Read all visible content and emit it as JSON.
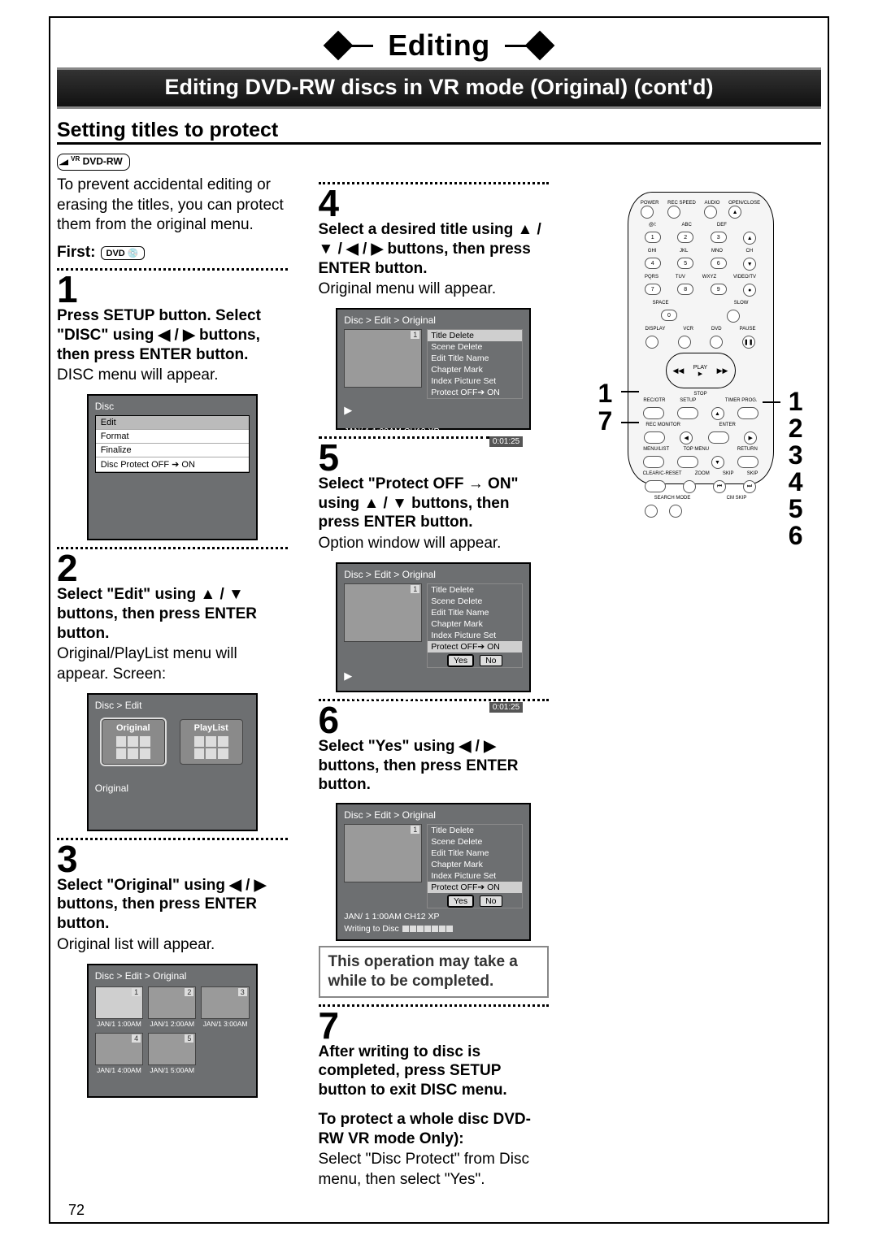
{
  "chapter_title": "Editing",
  "section_banner": "Editing DVD-RW discs in VR mode (Original) (cont'd)",
  "subheading": "Setting titles to protect",
  "dvdrw_badge_top": "VR",
  "dvdrw_badge": "DVD-RW",
  "intro": "To prevent accidental editing or erasing the titles, you can protect them from the original menu.",
  "first_label": "First:",
  "dvd_icon_label": "DVD",
  "page_number": "72",
  "steps": {
    "s1": {
      "num": "1",
      "head": "Press SETUP button. Select \"DISC\" using ◀ / ▶ buttons, then press ENTER button.",
      "body": "DISC menu will appear."
    },
    "s2": {
      "num": "2",
      "head": "Select \"Edit\" using ▲ / ▼ buttons, then press ENTER button.",
      "body": "Original/PlayList menu will appear. Screen:"
    },
    "s3": {
      "num": "3",
      "head": "Select \"Original\" using ◀ / ▶ buttons, then press ENTER button.",
      "body": "Original list will appear."
    },
    "s4": {
      "num": "4",
      "head": "Select a desired title using ▲ / ▼ / ◀ / ▶ buttons, then press ENTER button.",
      "body": "Original menu will appear."
    },
    "s5": {
      "num": "5",
      "head": "Select \"Protect OFF → ON\" using ▲ / ▼ buttons, then press ENTER button.",
      "body": "Option window will appear."
    },
    "s6": {
      "num": "6",
      "head": "Select \"Yes\" using ◀ / ▶ buttons, then press ENTER button."
    },
    "s7": {
      "num": "7",
      "head": "After writing to disc is completed, press SETUP button to exit DISC menu."
    }
  },
  "note_box": "This operation may take a while to be completed.",
  "whole_disc": {
    "head": "To protect a whole disc DVD-RW VR mode Only):",
    "body": "Select \"Disc Protect\" from Disc menu, then select \"Yes\"."
  },
  "screens": {
    "disc_menu": {
      "crumb": "Disc",
      "items": [
        "Edit",
        "Format",
        "Finalize",
        "Disc Protect OFF ➔ ON"
      ]
    },
    "orig_play": {
      "crumb": "Disc > Edit",
      "left": "Original",
      "right": "PlayList",
      "caption": "Original"
    },
    "orig_list": {
      "crumb": "Disc > Edit > Original",
      "thumbs": [
        {
          "n": "1",
          "t": "JAN/1  1:00AM"
        },
        {
          "n": "2",
          "t": "JAN/1  2:00AM"
        },
        {
          "n": "3",
          "t": "JAN/1  3:00AM"
        },
        {
          "n": "4",
          "t": "JAN/1  4:00AM"
        },
        {
          "n": "5",
          "t": "JAN/1  5:00AM"
        }
      ]
    },
    "edit_menu": {
      "crumb": "Disc > Edit > Original",
      "items": [
        "Title Delete",
        "Scene Delete",
        "Edit Title Name",
        "Chapter Mark",
        "Index Picture Set",
        "Protect OFF➔ ON"
      ],
      "footer_left": "JAN/ 1   1:00AM  CH12    XP",
      "footer_right": "0:01:25"
    },
    "yesno": {
      "yes": "Yes",
      "no": "No"
    },
    "writing": "Writing to Disc"
  },
  "remote": {
    "row1": [
      "POWER",
      "REC SPEED",
      "AUDIO",
      "OPEN/CLOSE"
    ],
    "numpad_labels": [
      "@/:",
      "ABC",
      "DEF",
      "",
      "GHI",
      "JKL",
      "MNO",
      "CH",
      "PQRS",
      "TUV",
      "WXYZ",
      "VIDEO/TV"
    ],
    "numpad": [
      "1",
      "2",
      "3",
      "▲",
      "4",
      "5",
      "6",
      "▼",
      "7",
      "8",
      "9",
      "●"
    ],
    "space": "SPACE",
    "zero": "0",
    "slow": "SLOW",
    "row_mode": [
      "DISPLAY",
      "VCR",
      "DVD",
      "PAUSE"
    ],
    "play": "PLAY",
    "rew": "◀◀",
    "ff": "▶▶",
    "stop": "STOP",
    "row_setup": [
      "REC/OTR",
      "SETUP",
      "",
      "TIMER PROG."
    ],
    "row_enter": [
      "REC MONITOR",
      "",
      "ENTER",
      ""
    ],
    "row_menu": [
      "MENU/LIST",
      "TOP MENU",
      "",
      "RETURN"
    ],
    "row_zoom": [
      "CLEAR/C-RESET",
      "ZOOM",
      "SKIP",
      "SKIP"
    ],
    "row_search": [
      "SEARCH MODE",
      "CM SKIP",
      "",
      ""
    ],
    "left_nums": [
      "1",
      "7"
    ],
    "right_nums": [
      "1",
      "2",
      "3",
      "4",
      "5",
      "6"
    ]
  }
}
